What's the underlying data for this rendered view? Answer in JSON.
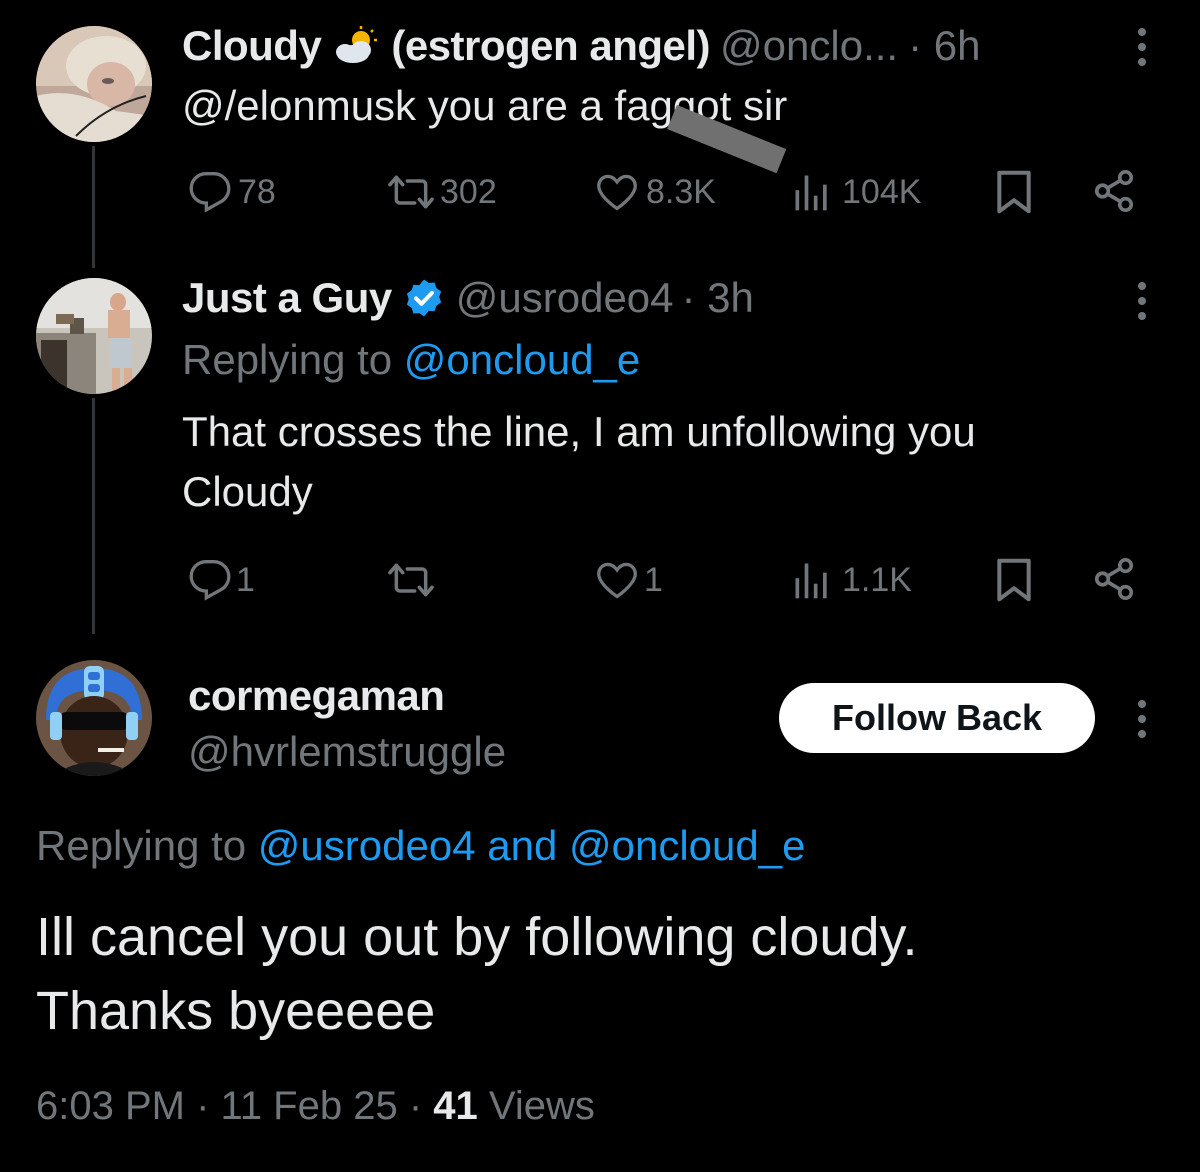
{
  "tweet1": {
    "name": "Cloudy",
    "emoji": "⛅",
    "name_suffix": "(estrogen angel)",
    "handle": "@onclo...",
    "time": "· 6h",
    "text_prefix": "@/elonmusk you are a f",
    "text_obscured": "ag",
    "text_suffix": "got sir",
    "replies": "78",
    "retweets": "302",
    "likes": "8.3K",
    "views": "104K"
  },
  "tweet2": {
    "name": "Just a Guy",
    "handle": "@usrodeo4",
    "time": "· 3h",
    "replying_to_label": "Replying to",
    "replying_to_handle": "@oncloud_e",
    "text": "That crosses the line, I am unfollowing you Cloudy",
    "replies": "1",
    "likes": "1",
    "views": "1.1K"
  },
  "tweet3": {
    "name": "cormegaman",
    "handle": "@hvrlemstruggle",
    "follow_label": "Follow Back",
    "replying_to_label": "Replying to",
    "replying_to_handles": "@usrodeo4 and @oncloud_e",
    "text_line1": "Ill cancel you out by following cloudy.",
    "text_line2": "Thanks byeeeee",
    "time": "6:03 PM",
    "date": "11 Feb 25",
    "views_count": "41",
    "views_label": "Views",
    "sep": "·"
  },
  "colors": {
    "background": "#000000",
    "text": "#e7e9ea",
    "secondary": "#71767b",
    "link": "#1d9bf0"
  }
}
